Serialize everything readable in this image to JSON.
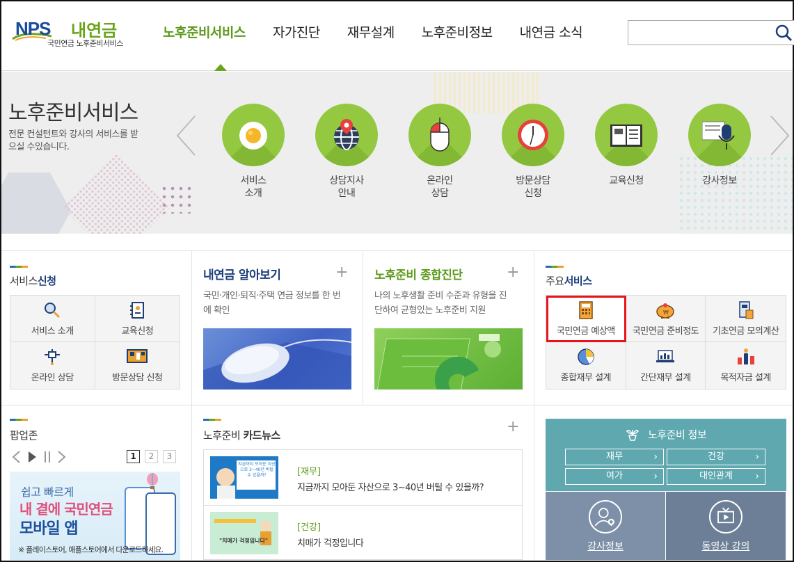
{
  "header": {
    "logo_nps": "NPS",
    "logo_name": "내연금",
    "logo_sub": "국민연금 노후준비서비스",
    "nav": [
      "노후준비서비스",
      "자가진단",
      "재무설계",
      "노후준비정보",
      "내연금 소식"
    ],
    "search_placeholder": ""
  },
  "banner": {
    "title": "노후준비서비스",
    "desc": "전문 컨설턴트와 강사의 서비스를 받으실 수있습니다.",
    "services": [
      {
        "label": "서비스\n소개",
        "icon": "egg-icon"
      },
      {
        "label": "상담지사\n안내",
        "icon": "globe-pin-icon"
      },
      {
        "label": "온라인\n상담",
        "icon": "mouse-icon"
      },
      {
        "label": "방문상담\n신청",
        "icon": "clock-icon"
      },
      {
        "label": "교육신청",
        "icon": "book-icon"
      },
      {
        "label": "강사정보",
        "icon": "microphone-icon"
      }
    ]
  },
  "service_apply": {
    "title_plain": "서비스",
    "title_bold": "신청",
    "items": [
      "서비스 소개",
      "교육신청",
      "온라인 상담",
      "방문상담 신청"
    ]
  },
  "my_pension": {
    "title": "내연금 알아보기",
    "desc": "국민·개인·퇴직·주택 연금 정보를 한 번에 확인"
  },
  "diagnosis": {
    "title": "노후준비 종합진단",
    "desc": "나의 노후생활 준비 수준과 유형을 진단하여 균형있는 노후준비 지원"
  },
  "main_services": {
    "title_plain": "주요",
    "title_bold": "서비스",
    "items": [
      "국민연금 예상액",
      "국민연금 준비정도",
      "기초연금 모의계산",
      "종합재무 설계",
      "간단재무 설계",
      "목적자금 설계"
    ]
  },
  "popup_zone": {
    "title_plain": "팝업",
    "title_bold": "존",
    "pages": [
      "1",
      "2",
      "3"
    ],
    "current_page": 1,
    "line1": "쉽고 빠르게",
    "line2": "내 곁에 국민연금",
    "line3": "모바일 앱",
    "line4": "※ 플레이스토어, 애플스토어에서 다운로드하세요."
  },
  "card_news": {
    "title_plain": "노후준비 ",
    "title_bold": "카드뉴스",
    "items": [
      {
        "category": "[재무]",
        "text": "지금까지 모아둔 자산으로 3~40년 버틸 수 있을까?",
        "thumb_text": "지금까지 모아둔 자산으로 3~40년 버틸 수 있을까?"
      },
      {
        "category": "[건강]",
        "text": "치매가 걱정입니다",
        "thumb_text": "\"치매가 걱정입니다\""
      }
    ]
  },
  "info": {
    "title": "노후준비 정보",
    "buttons": [
      "재무",
      "건강",
      "여가",
      "대인관계"
    ],
    "lower": [
      "강사정보",
      "동영상 강의"
    ]
  },
  "colors": {
    "brand_green": "#6aa41a",
    "brand_blue": "#1a4c9c",
    "teal_panel": "#5fa8b0",
    "highlight_red": "#e8141b"
  }
}
